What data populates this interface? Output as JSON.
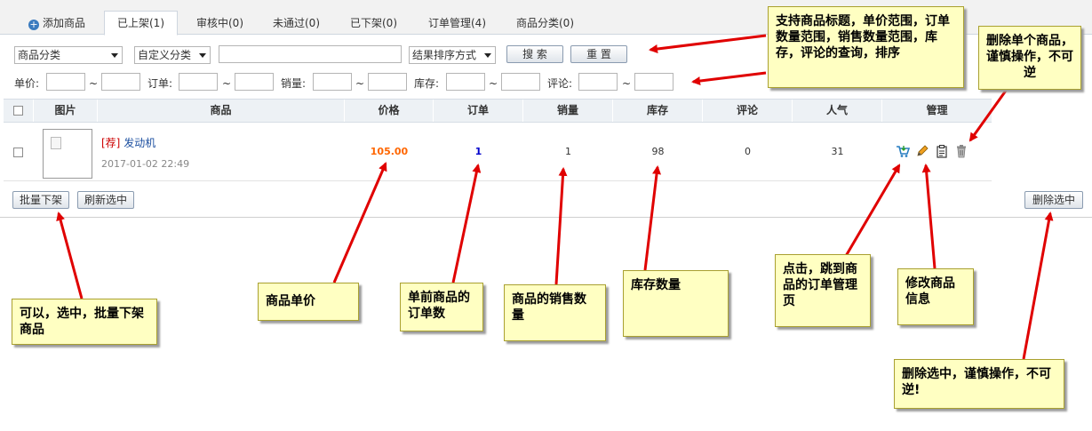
{
  "tabs": [
    {
      "label": "添加商品"
    },
    {
      "label": "已上架(1)"
    },
    {
      "label": "审核中(0)"
    },
    {
      "label": "未通过(0)"
    },
    {
      "label": "已下架(0)"
    },
    {
      "label": "订单管理(4)"
    },
    {
      "label": "商品分类(0)"
    }
  ],
  "filters": {
    "category": "商品分类",
    "custom_category": "自定义分类",
    "sort": "结果排序方式",
    "search_btn": "搜 索",
    "reset_btn": "重 置",
    "price": "单价:",
    "order": "订单:",
    "sales": "销量:",
    "stock": "库存:",
    "comment": "评论:",
    "tilde": "~"
  },
  "table": {
    "headers": [
      "图片",
      "商品",
      "价格",
      "订单",
      "销量",
      "库存",
      "评论",
      "人气",
      "管理"
    ],
    "row": {
      "tag": "[荐]",
      "name": "发动机",
      "date": "2017-01-02 22:49",
      "price": "105.00",
      "orders": "1",
      "sales": "1",
      "stock": "98",
      "comments": "0",
      "popularity": "31"
    }
  },
  "bulk": {
    "offline": "批量下架",
    "refresh": "刷新选中",
    "delete": "删除选中"
  },
  "notes": {
    "search": "支持商品标题，单价范围，订单数量范围，销售数量范围，库存，评论的查询，排序",
    "delete_one": "删除单个商品，谨慎操作，不可逆",
    "bulk_offline": "可以，选中，批量下架商品",
    "price": "商品单价",
    "orders": "单前商品的订单数",
    "sales": "商品的销售数量",
    "stock": "库存数量",
    "order_page": "点击，跳到商品的订单管理页",
    "edit": "修改商品信息",
    "delete_sel": "删除选中，谨慎操作，不可逆!"
  },
  "colors": {
    "price": "#ff6600",
    "orders": "#0000cc",
    "note_bg": "#ffffc2",
    "arrow": "#e00000"
  }
}
